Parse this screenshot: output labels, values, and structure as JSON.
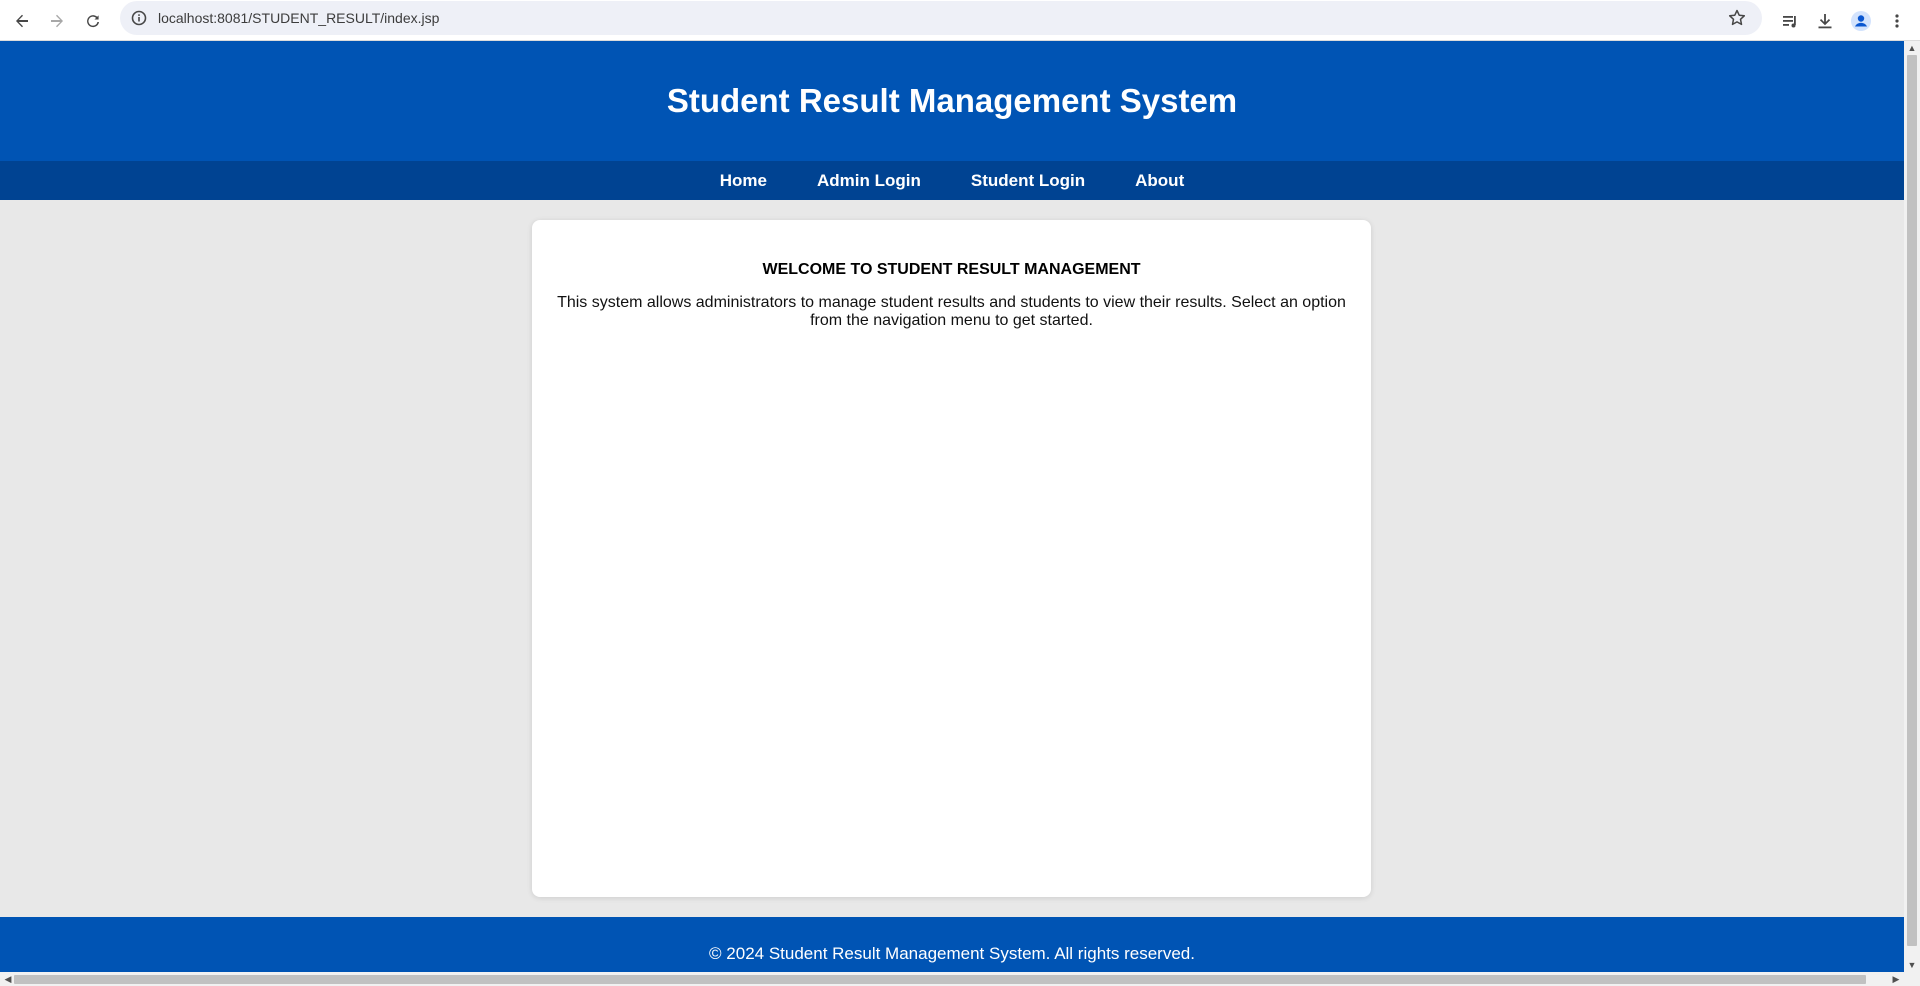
{
  "browser": {
    "url": "localhost:8081/STUDENT_RESULT/index.jsp"
  },
  "header": {
    "title": "Student Result Management System"
  },
  "nav": {
    "items": [
      "Home",
      "Admin Login",
      "Student Login",
      "About"
    ]
  },
  "main": {
    "heading": "WELCOME TO STUDENT RESULT MANAGEMENT",
    "description": "This system allows administrators to manage student results and students to view their results. Select an option from the navigation menu to get started."
  },
  "footer": {
    "text": "© 2024 Student Result Management System. All rights reserved."
  },
  "colors": {
    "header_bg": "#0054b4",
    "nav_bg": "#004392",
    "page_bg": "#e8e8e8"
  }
}
